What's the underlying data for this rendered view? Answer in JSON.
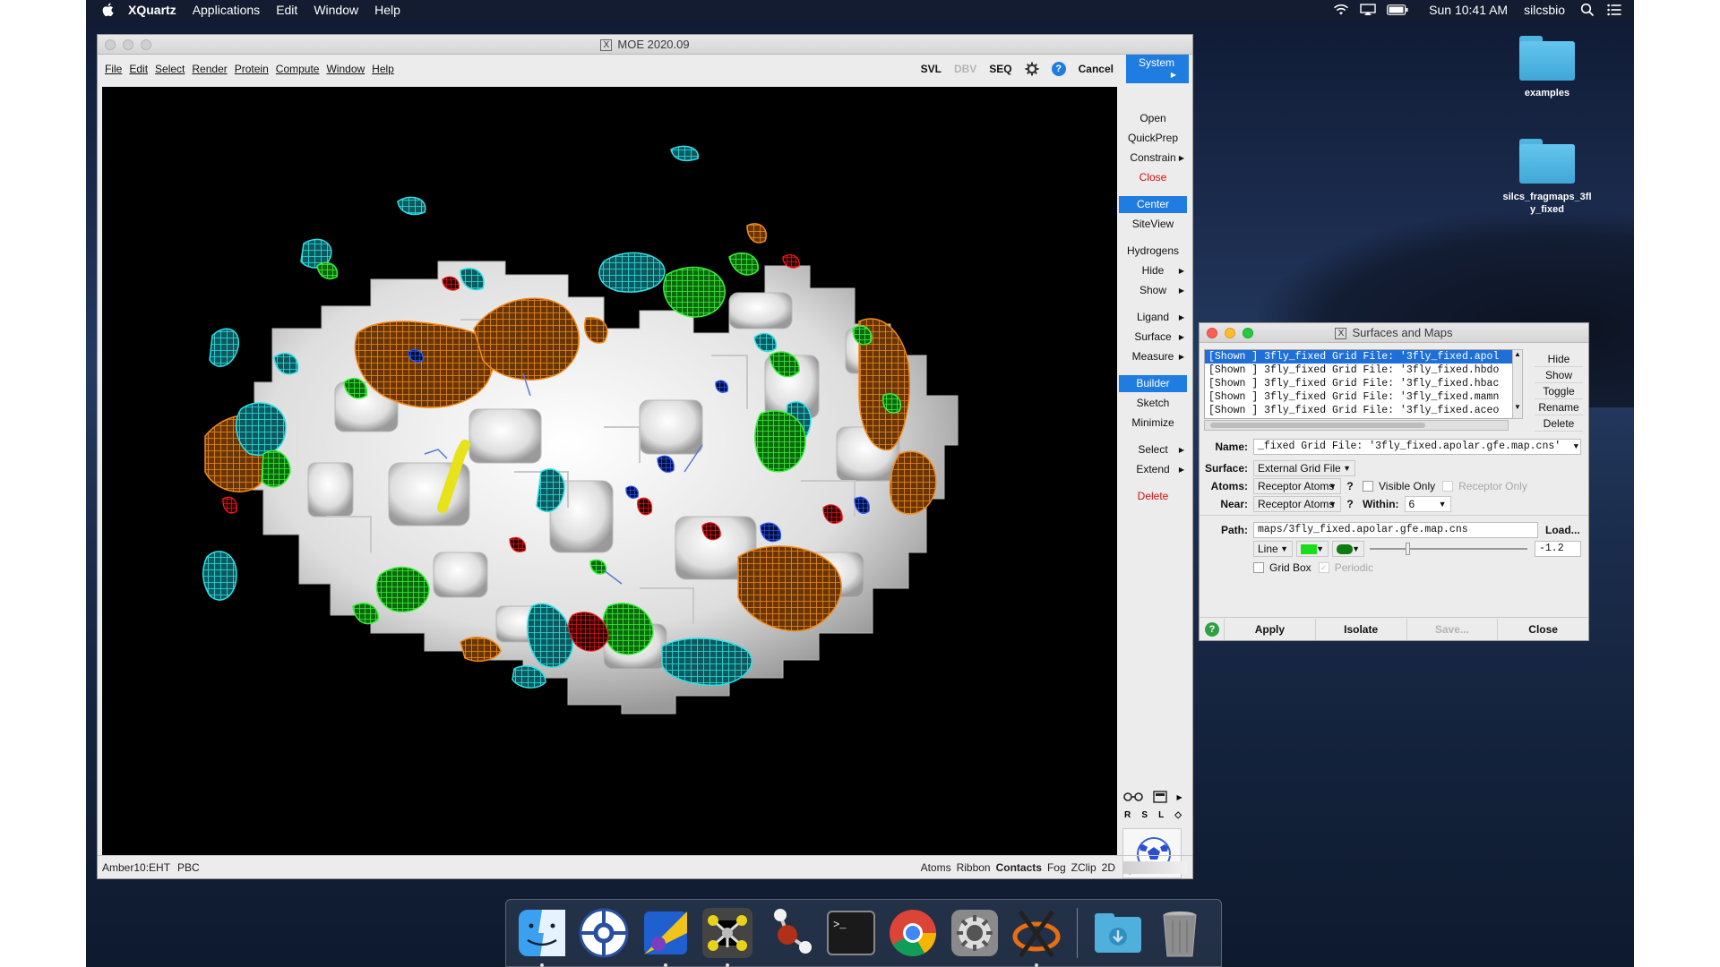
{
  "menubar": {
    "app_name": "XQuartz",
    "items": [
      "Applications",
      "Edit",
      "Window",
      "Help"
    ],
    "clock": "Sun 10:41 AM",
    "user": "silcsbio"
  },
  "desktop": {
    "icons": [
      {
        "label": "examples",
        "icon": "folder-icon"
      },
      {
        "label": "silcs_fragmaps_3fly_fixed",
        "icon": "folder-icon"
      }
    ]
  },
  "moe": {
    "title": "MOE 2020.09",
    "menu": [
      "File",
      "Edit",
      "Select",
      "Render",
      "Protein",
      "Compute",
      "Window",
      "Help"
    ],
    "toolbar": {
      "svl": "SVL",
      "dbv": "DBV",
      "seq": "SEQ",
      "cancel": "Cancel",
      "system": "System"
    },
    "side": {
      "group1": [
        "Open",
        "QuickPrep",
        "Constrain",
        "Close"
      ],
      "group2": [
        "Center",
        "SiteView"
      ],
      "group3": [
        "Hydrogens",
        "Hide",
        "Show"
      ],
      "group4": [
        "Ligand",
        "Surface",
        "Measure"
      ],
      "group5": [
        "Builder",
        "Sketch",
        "Minimize"
      ],
      "group6": [
        "Select",
        "Extend"
      ],
      "delete": "Delete",
      "view_keys": [
        "R",
        "S",
        "L"
      ]
    },
    "status_left": [
      "Amber10:EHT",
      "PBC"
    ],
    "status_right": [
      "Atoms",
      "Ribbon",
      "Contacts",
      "Fog",
      "ZClip",
      "2D"
    ]
  },
  "surfaces": {
    "title": "Surfaces and Maps",
    "list": [
      "[Shown ] 3fly_fixed Grid File: '3fly_fixed.apol",
      "[Shown ] 3fly_fixed Grid File: '3fly_fixed.hbdo",
      "[Shown ] 3fly_fixed Grid File: '3fly_fixed.hbac",
      "[Shown ] 3fly_fixed Grid File: '3fly_fixed.mamn",
      "[Shown ] 3fly_fixed Grid File: '3fly_fixed.aceo"
    ],
    "right_buttons": [
      "Hide",
      "Show",
      "Toggle",
      "Rename",
      "Delete"
    ],
    "name_label": "Name:",
    "name_value": "_fixed Grid File: '3fly_fixed.apolar.gfe.map.cns'",
    "surface_label": "Surface:",
    "surface_value": "External Grid File",
    "atoms_label": "Atoms:",
    "atoms_value": "Receptor Atoms",
    "visible_only": "Visible Only",
    "receptor_only": "Receptor Only",
    "near_label": "Near:",
    "near_value": "Receptor Atoms",
    "within_label": "Within:",
    "within_value": "6",
    "path_label": "Path:",
    "path_value": "maps/3fly_fixed.apolar.gfe.map.cns",
    "load": "Load...",
    "style_value": "Line",
    "level_value": "-1.2",
    "gridbox": "Grid Box",
    "periodic": "Periodic",
    "buttons": [
      "Apply",
      "Isolate",
      "Save...",
      "Close"
    ],
    "colors": {
      "map_color": "#18e018",
      "surface_color": "#0f7a0f"
    }
  },
  "dock": {
    "apps": [
      "finder-icon",
      "browser-icon",
      "pymol-icon",
      "moe-icon",
      "molecule-icon",
      "terminal-icon",
      "chrome-icon",
      "system-preferences-icon",
      "xquartz-icon",
      "downloads-folder-icon",
      "trash-icon"
    ]
  },
  "colors": {
    "accent": "#1f7ce0",
    "delete_red": "#d01010",
    "map_cyan": "#19c7cf",
    "map_orange": "#e8780f",
    "map_green": "#1ec41e",
    "map_red": "#d41414"
  }
}
